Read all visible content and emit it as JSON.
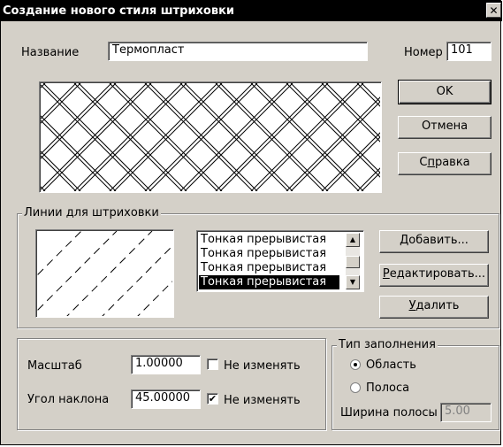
{
  "dialog": {
    "title": "Создание нового стиля штриховки",
    "close_glyph": "✕"
  },
  "name": {
    "label": "Название",
    "value": "Термопласт"
  },
  "number": {
    "label": "Номер",
    "value": "101"
  },
  "buttons": {
    "ok": "OK",
    "cancel": "Отмена",
    "help_pre": "С",
    "help_u": "п",
    "help_post": "равка",
    "add_u": "Д",
    "add_post": "обавить...",
    "edit_u": "Р",
    "edit_post": "едактировать...",
    "delete_u": "У",
    "delete_post": "далить"
  },
  "lines_group": {
    "label": "Линии для штриховки",
    "items": [
      "Тонкая прерывистая",
      "Тонкая прерывистая",
      "Тонкая прерывистая",
      "Тонкая прерывистая"
    ],
    "selected_index": 3
  },
  "scale": {
    "label": "Масштаб",
    "value": "1.00000",
    "keep_label": "Не изменять",
    "keep_checked": false
  },
  "angle": {
    "label": "Угол наклона",
    "value": "45.00000",
    "keep_label": "Не изменять",
    "keep_checked": true
  },
  "fill_type": {
    "label": "Тип заполнения",
    "options": [
      "Область",
      "Полоса"
    ],
    "selected": "Область",
    "strip_width_label": "Ширина полосы",
    "strip_width_value": "5.00"
  },
  "icons": {
    "check": "✔",
    "arrow_up": "▲",
    "arrow_down": "▼"
  }
}
